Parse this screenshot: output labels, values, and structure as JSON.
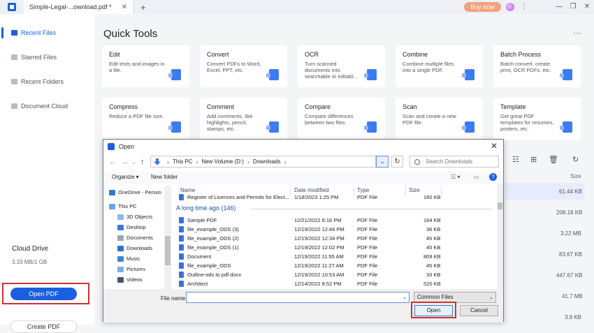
{
  "titlebar": {
    "tab_label": "Simple-Legal-...ownload.pdf *",
    "tab_close": "✕",
    "tab_add": "+",
    "buy_now": "Buy now"
  },
  "sidebar": {
    "items": [
      {
        "label": "Recent Files"
      },
      {
        "label": "Starred Files"
      },
      {
        "label": "Recent Folders"
      },
      {
        "label": "Document Cloud"
      }
    ],
    "cloud_title": "Cloud Drive",
    "cloud_size": "3.33 MB/1 GB",
    "open_pdf": "Open PDF",
    "create_pdf": "Create PDF"
  },
  "main": {
    "title": "Quick Tools",
    "more": "···",
    "cards": [
      {
        "title": "Edit",
        "desc": "Edit texts and images in a file."
      },
      {
        "title": "Convert",
        "desc": "Convert PDFs to Word, Excel, PPT, etc."
      },
      {
        "title": "OCR",
        "desc": "Turn scanned documents into searchable or editabl..."
      },
      {
        "title": "Combine",
        "desc": "Combine multiple files into a single PDF."
      },
      {
        "title": "Batch Process",
        "desc": "Batch convert, create, print, OCR PDFs, etc."
      },
      {
        "title": "Compress",
        "desc": "Reduce a PDF file size."
      },
      {
        "title": "Comment",
        "desc": "Add comments, like highlights, pencil, stamps, etc."
      },
      {
        "title": "Compare",
        "desc": "Compare differences between two files."
      },
      {
        "title": "Scan",
        "desc": "Scan and create a new PDF file."
      },
      {
        "title": "Template",
        "desc": "Get great PDF templates for resumes, posters, etc."
      }
    ],
    "size_header": "Size",
    "sizes": [
      "61.44 KB",
      "208.18 KB",
      "3.22 MB",
      "83.67 KB",
      "447.67 KB",
      "41.7 MB",
      "3.8 KB"
    ]
  },
  "dialog": {
    "title": "Open",
    "path": [
      "This PC",
      "New Volume (D:)",
      "Downloads"
    ],
    "search_placeholder": "Search Downloads",
    "organize": "Organize ▾",
    "new_folder": "New folder",
    "nav_items": [
      "OneDrive - Person",
      "This PC",
      "3D Objects",
      "Desktop",
      "Documents",
      "Downloads",
      "Music",
      "Pictures",
      "Videos"
    ],
    "columns": [
      "Name",
      "Date modified",
      "Type",
      "Size"
    ],
    "first_row": {
      "name": "Register of Licences and Permits for Elect...",
      "date": "1/18/2023 1:25 PM",
      "type": "PDF File",
      "size": "160 KB"
    },
    "group_label": "A long time ago (146)",
    "files": [
      {
        "name": "Sample PDF",
        "date": "12/21/2022 8:16 PM",
        "type": "PDF File",
        "size": "164 KB"
      },
      {
        "name": "file_example_ODS (3)",
        "date": "12/19/2022 12:46 PM",
        "type": "PDF File",
        "size": "36 KB"
      },
      {
        "name": "file_example_ODS (2)",
        "date": "12/19/2022 12:34 PM",
        "type": "PDF File",
        "size": "45 KB"
      },
      {
        "name": "file_example_ODS (1)",
        "date": "12/19/2022 12:02 PM",
        "type": "PDF File",
        "size": "45 KB"
      },
      {
        "name": "Document",
        "date": "12/19/2022 11:55 AM",
        "type": "PDF File",
        "size": "809 KB"
      },
      {
        "name": "file_example_ODS",
        "date": "12/19/2022 11:27 AM",
        "type": "PDF File",
        "size": "45 KB"
      },
      {
        "name": "Outline-ods to pdf.docx",
        "date": "12/19/2022 10:53 AM",
        "type": "PDF File",
        "size": "33 KB"
      },
      {
        "name": "Architect",
        "date": "12/14/2022 8:52 PM",
        "type": "PDF File",
        "size": "520 KB"
      }
    ],
    "file_name_label": "File name:",
    "file_name_value": "",
    "file_type": "Common Files",
    "open_button": "Open",
    "cancel_button": "Cancel"
  }
}
